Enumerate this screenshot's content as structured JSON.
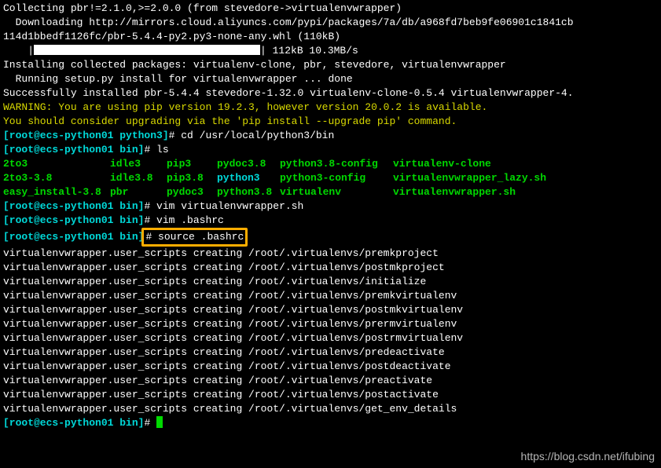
{
  "lines": {
    "collecting": "Collecting pbr!=2.1.0,>=2.0.0 (from stevedore->virtualenvwrapper)",
    "downloading": "  Downloading http://mirrors.cloud.aliyuncs.com/pypi/packages/7a/db/a968fd7beb9fe06901c1841cb",
    "whl": "114d1bbedf1126fc/pbr-5.4.4-py2.py3-none-any.whl (110kB)",
    "progress_prefix": "    |",
    "progress_suffix": "| 112kB 10.3MB/s",
    "installing": "Installing collected packages: virtualenv-clone, pbr, stevedore, virtualenvwrapper",
    "running_setup": "  Running setup.py install for virtualenvwrapper ... done",
    "success": "Successfully installed pbr-5.4.4 stevedore-1.32.0 virtualenv-clone-0.5.4 virtualenvwrapper-4.",
    "warning": "WARNING: You are using pip version 19.2.3, however version 20.0.2 is available.",
    "upgrade": "You should consider upgrading via the 'pip install --upgrade pip' command."
  },
  "prompts": {
    "p1_prefix": "[root@ecs-python01 python3]",
    "p1_cmd": "# cd /usr/local/python3/bin",
    "p2_prefix": "[root@ecs-python01 bin]",
    "p2_cmd": "# ls",
    "p3_cmd": "# vim virtualenvwrapper.sh",
    "p4_cmd": "# vim .bashrc",
    "p5_cmd": "# source .bashrc",
    "p6_cmd": "# "
  },
  "ls": {
    "r1": {
      "c1": "2to3",
      "c2": "idle3",
      "c3": "pip3",
      "c4": "pydoc3.8",
      "c5": "python3.8-config",
      "c6": "virtualenv-clone"
    },
    "r2": {
      "c1": "2to3-3.8",
      "c2": "idle3.8",
      "c3": "pip3.8",
      "c4": "python3",
      "c5": "python3-config",
      "c6": "virtualenvwrapper_lazy.sh"
    },
    "r3": {
      "c1": "easy_install-3.8",
      "c2": "pbr",
      "c3": "pydoc3",
      "c4": "python3.8",
      "c5": "virtualenv",
      "c6": "virtualenvwrapper.sh"
    }
  },
  "scripts": {
    "s1": "virtualenvwrapper.user_scripts creating /root/.virtualenvs/premkproject",
    "s2": "virtualenvwrapper.user_scripts creating /root/.virtualenvs/postmkproject",
    "s3": "virtualenvwrapper.user_scripts creating /root/.virtualenvs/initialize",
    "s4": "virtualenvwrapper.user_scripts creating /root/.virtualenvs/premkvirtualenv",
    "s5": "virtualenvwrapper.user_scripts creating /root/.virtualenvs/postmkvirtualenv",
    "s6": "virtualenvwrapper.user_scripts creating /root/.virtualenvs/prermvirtualenv",
    "s7": "virtualenvwrapper.user_scripts creating /root/.virtualenvs/postrmvirtualenv",
    "s8": "virtualenvwrapper.user_scripts creating /root/.virtualenvs/predeactivate",
    "s9": "virtualenvwrapper.user_scripts creating /root/.virtualenvs/postdeactivate",
    "s10": "virtualenvwrapper.user_scripts creating /root/.virtualenvs/preactivate",
    "s11": "virtualenvwrapper.user_scripts creating /root/.virtualenvs/postactivate",
    "s12": "virtualenvwrapper.user_scripts creating /root/.virtualenvs/get_env_details"
  },
  "watermark": "https://blog.csdn.net/ifubing"
}
